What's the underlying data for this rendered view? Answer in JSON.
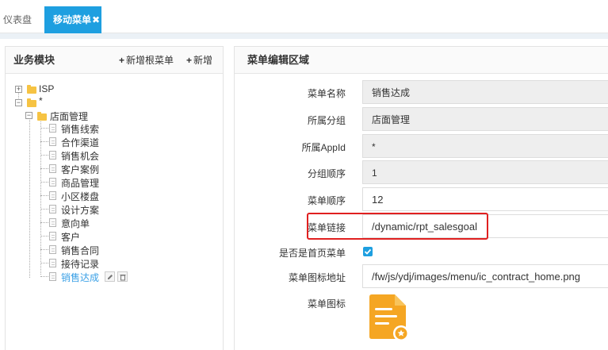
{
  "tabs": [
    {
      "label": "仪表盘",
      "active": false
    },
    {
      "label": "移动菜单",
      "active": true
    }
  ],
  "left_panel": {
    "title": "业务模块",
    "actions": [
      {
        "label": "新增根菜单"
      },
      {
        "label": "新增"
      }
    ],
    "tree": {
      "root1": "ISP",
      "root2": "*",
      "group": "店面管理",
      "items": [
        "销售线索",
        "合作渠道",
        "销售机会",
        "客户案例",
        "商品管理",
        "小区楼盘",
        "设计方案",
        "意向单",
        "客户",
        "销售合同",
        "接待记录",
        "销售达成"
      ],
      "selected_item": "销售达成"
    }
  },
  "right_panel": {
    "title": "菜单编辑区域",
    "fields": {
      "menu_name": {
        "label": "菜单名称",
        "value": "销售达成"
      },
      "group": {
        "label": "所属分组",
        "value": "店面管理"
      },
      "app_id": {
        "label": "所属AppId",
        "value": "*"
      },
      "group_order": {
        "label": "分组顺序",
        "value": "1"
      },
      "menu_order": {
        "label": "菜单顺序",
        "value": "12"
      },
      "menu_link": {
        "label": "菜单链接",
        "value": "/dynamic/rpt_salesgoal"
      },
      "is_home": {
        "label": "是否是首页菜单",
        "checked": true
      },
      "icon_url": {
        "label": "菜单图标地址",
        "value": "/fw/js/ydj/images/menu/ic_contract_home.png"
      },
      "icon": {
        "label": "菜单图标"
      }
    }
  },
  "colors": {
    "accent": "#1e9fe0",
    "highlight": "#e02020",
    "icon_orange": "#f5a623"
  }
}
